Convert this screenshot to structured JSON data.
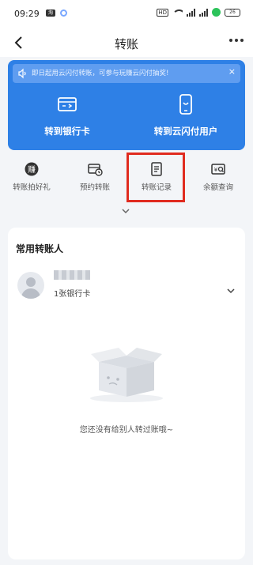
{
  "status_bar": {
    "time": "09:29",
    "left_badge": "淘",
    "hd_label": "HD",
    "battery": "26"
  },
  "header": {
    "title": "转账"
  },
  "notice": {
    "text": "即日起用云闪付转账，可参与玩赚云闪付抽奖!",
    "close": "×"
  },
  "hero_actions": [
    {
      "label": "转到银行卡",
      "icon": "bank-card-icon"
    },
    {
      "label": "转到云闪付用户",
      "icon": "phone-user-icon"
    }
  ],
  "functions": [
    {
      "label": "转账拍好礼",
      "icon": "earn-icon"
    },
    {
      "label": "预约转账",
      "icon": "scheduled-transfer-icon"
    },
    {
      "label": "转账记录",
      "icon": "record-icon",
      "highlighted": true
    },
    {
      "label": "余额查询",
      "icon": "balance-check-icon"
    }
  ],
  "contacts": {
    "title": "常用转账人",
    "items": [
      {
        "sub": "1张银行卡"
      }
    ]
  },
  "empty_state": {
    "text": "您还没有给别人转过账哦~"
  },
  "colors": {
    "primary_blue": "#2e80e6",
    "highlight_red": "#e02b1f",
    "background": "#f3f5f8"
  }
}
